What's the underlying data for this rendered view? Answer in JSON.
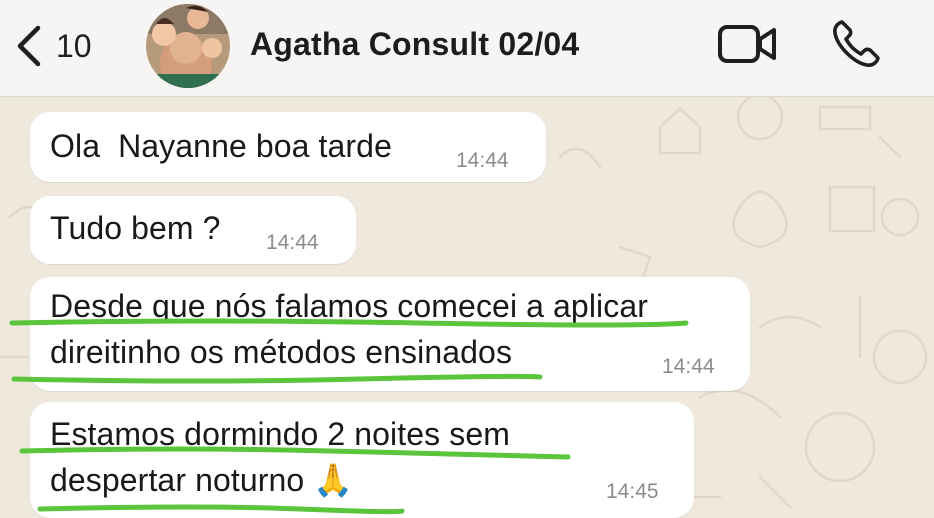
{
  "header": {
    "back_count": "10",
    "contact_name": "Agatha Consult 02/04"
  },
  "messages": [
    {
      "lines": [
        "Ola  Nayanne boa tarde"
      ],
      "time": "14:44"
    },
    {
      "lines": [
        "Tudo bem ?"
      ],
      "time": "14:44"
    },
    {
      "lines": [
        "Desde que nós falamos comecei a aplicar",
        "direitinho os métodos ensinados"
      ],
      "time": "14:44"
    },
    {
      "lines": [
        "Estamos dormindo 2 noites sem",
        "despertar noturno"
      ],
      "emoji": "🙏",
      "time": "14:45"
    }
  ],
  "colors": {
    "header_bg": "#f6f5f3",
    "wallpaper": "#efe8dd",
    "bubble": "#ffffff",
    "highlight_underline": "#5ac43a",
    "timestamp": "#8c8c8c"
  },
  "icons": [
    "chevron-left-icon",
    "avatar",
    "video-camera-icon",
    "phone-icon",
    "folded-hands-emoji"
  ]
}
